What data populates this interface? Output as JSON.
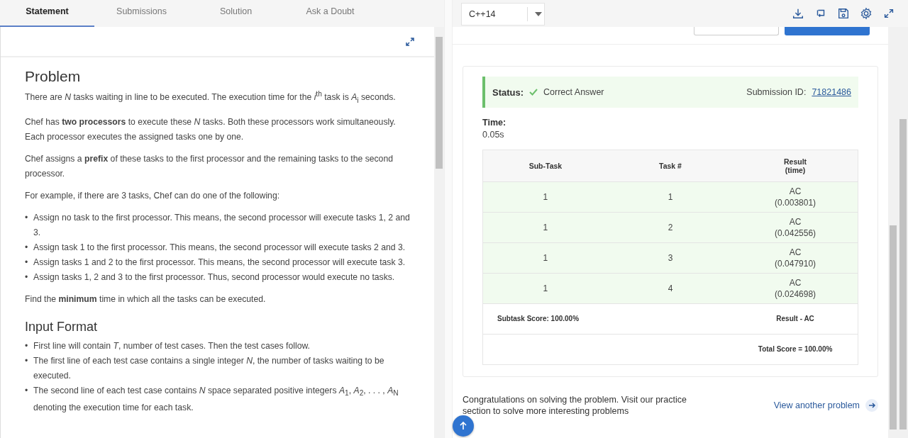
{
  "tabs": [
    {
      "label": "Statement",
      "selected": true
    },
    {
      "label": "Submissions",
      "selected": false
    },
    {
      "label": "Solution",
      "selected": false
    },
    {
      "label": "Ask a Doubt",
      "selected": false
    }
  ],
  "statement": [
    {
      "kind": "heading",
      "text": "Problem"
    },
    {
      "kind": "paragraph",
      "text": "There are *N* tasks waiting in line to be executed. The execution time for the *i*$^{th}$ task is *A*$_{i}$ seconds."
    },
    {
      "kind": "paragraph",
      "text": "Chef has **two processors** to execute these *N* tasks. Both these processors work simultaneously. Each processor executes the assigned tasks one by one."
    },
    {
      "kind": "paragraph",
      "text": "Chef assigns a **prefix** of these tasks to the first processor and the remaining tasks to the second processor."
    },
    {
      "kind": "paragraph",
      "text": "For example, if there are 3 tasks, Chef can do one of the following:"
    },
    {
      "kind": "list",
      "marker": "•",
      "items": [
        "Assign no task to the first processor. This means, the second processor will execute tasks 1, 2 and 3.",
        "Assign task 1 to the first processor. This means, the second processor will execute tasks 2 and 3.",
        "Assign tasks 1 and 2 to the first processor. This means, the second processor will execute task 3.",
        "Assign tasks 1, 2 and 3 to the first processor. Thus, second processor would execute no tasks."
      ]
    },
    {
      "kind": "paragraph",
      "text": "Find the **minimum** time in which all the tasks can be executed."
    },
    {
      "kind": "heading",
      "text": "Input Format"
    },
    {
      "kind": "list",
      "marker": "•",
      "items": [
        "First line will contain *T*, number of test cases. Then the test cases follow.",
        "The first line of each test case contains a single integer *N*, the number of tasks waiting to be executed.",
        "The second line of each test case contains *N* space separated positive integers *A*$_{1}$, *A*$_{2}$, . . . , *A*$_{N}$ denoting the execution time for each task."
      ]
    }
  ],
  "editor": {
    "language": "C++14"
  },
  "result": {
    "status_label": "Status:",
    "status": "Correct Answer",
    "submission_label": "Submission ID:",
    "submission_id": "71821486",
    "time_label": "Time:",
    "time": "0.05s",
    "columns": [
      {
        "label": "Sub-Task"
      },
      {
        "label": "Task #"
      },
      {
        "label": "Result",
        "sublabel": "(time)"
      }
    ],
    "rows": [
      {
        "subtask": "1",
        "task": "1",
        "result": "AC",
        "time": "(0.003801)"
      },
      {
        "subtask": "1",
        "task": "2",
        "result": "AC",
        "time": "(0.042556)"
      },
      {
        "subtask": "1",
        "task": "3",
        "result": "AC",
        "time": "(0.047910)"
      },
      {
        "subtask": "1",
        "task": "4",
        "result": "AC",
        "time": "(0.024698)"
      }
    ],
    "subtask_score": "Subtask Score: 100.00%",
    "subtask_result": "Result - AC",
    "total_score": "Total Score = 100.00%"
  },
  "footer": {
    "message": "Congratulations on solving the problem. Visit our practice section to solve more interesting problems",
    "link": "View another problem"
  }
}
